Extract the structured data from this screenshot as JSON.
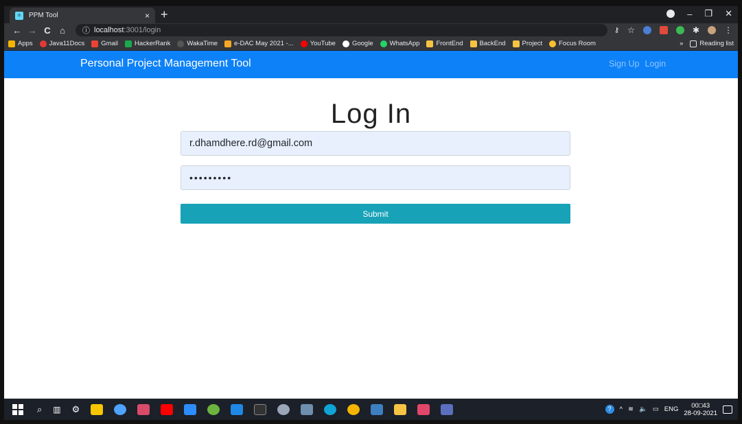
{
  "browser": {
    "tab_title": "PPM Tool",
    "tab_close": "×",
    "new_tab": "+",
    "address_host": "localhost",
    "address_path": ":3001/login",
    "nav_back": "←",
    "nav_forward": "→",
    "nav_reload": "C",
    "nav_home": "⌂",
    "info_icon": "ⓘ",
    "bookmarks": [
      "Apps",
      "Java11Docs",
      "Gmail",
      "HackerRank",
      "WakaTime",
      "e-DAC May 2021 -...",
      "YouTube",
      "Google",
      "WhatsApp",
      "FrontEnd",
      "BackEnd",
      "Project",
      "Focus Room"
    ],
    "bookmark_overflow": "»",
    "reading_list": "Reading list",
    "window_controls": [
      "–",
      "❐",
      "✕"
    ]
  },
  "app": {
    "brand": "Personal Project Management Tool",
    "nav_signup": "Sign Up",
    "nav_login": "Login",
    "heading": "Log In",
    "email_value": "r.dhamdhere.rd@gmail.com",
    "password_value": "•••••••••",
    "submit_label": "Submit",
    "navbar_color": "#0d81f7",
    "button_color": "#17a2b8"
  },
  "taskbar": {
    "language": "ENG",
    "time": "00□43",
    "date": "28-09-2021",
    "tray_chevron": "^"
  }
}
